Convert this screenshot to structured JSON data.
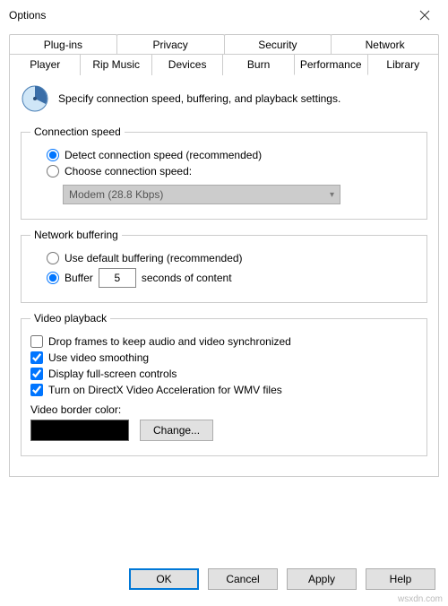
{
  "window": {
    "title": "Options"
  },
  "tabs": {
    "row1": [
      "Plug-ins",
      "Privacy",
      "Security",
      "Network"
    ],
    "row2": [
      "Player",
      "Rip Music",
      "Devices",
      "Burn",
      "Performance",
      "Library"
    ],
    "active": "Performance"
  },
  "intro": "Specify connection speed, buffering, and playback settings.",
  "connection": {
    "legend": "Connection speed",
    "detect": "Detect connection speed (recommended)",
    "choose": "Choose connection speed:",
    "select_value": "Modem (28.8 Kbps)"
  },
  "buffering": {
    "legend": "Network buffering",
    "default": "Use default buffering (recommended)",
    "buffer_label": "Buffer",
    "buffer_value": "5",
    "buffer_suffix": "seconds of content"
  },
  "video": {
    "legend": "Video playback",
    "drop": "Drop frames to keep audio and video synchronized",
    "smoothing": "Use video smoothing",
    "fullscreen": "Display full-screen controls",
    "directx": "Turn on DirectX Video Acceleration for WMV files",
    "border_label": "Video border color:",
    "change": "Change..."
  },
  "buttons": {
    "ok": "OK",
    "cancel": "Cancel",
    "apply": "Apply",
    "help": "Help"
  },
  "watermark": "wsxdn.com"
}
